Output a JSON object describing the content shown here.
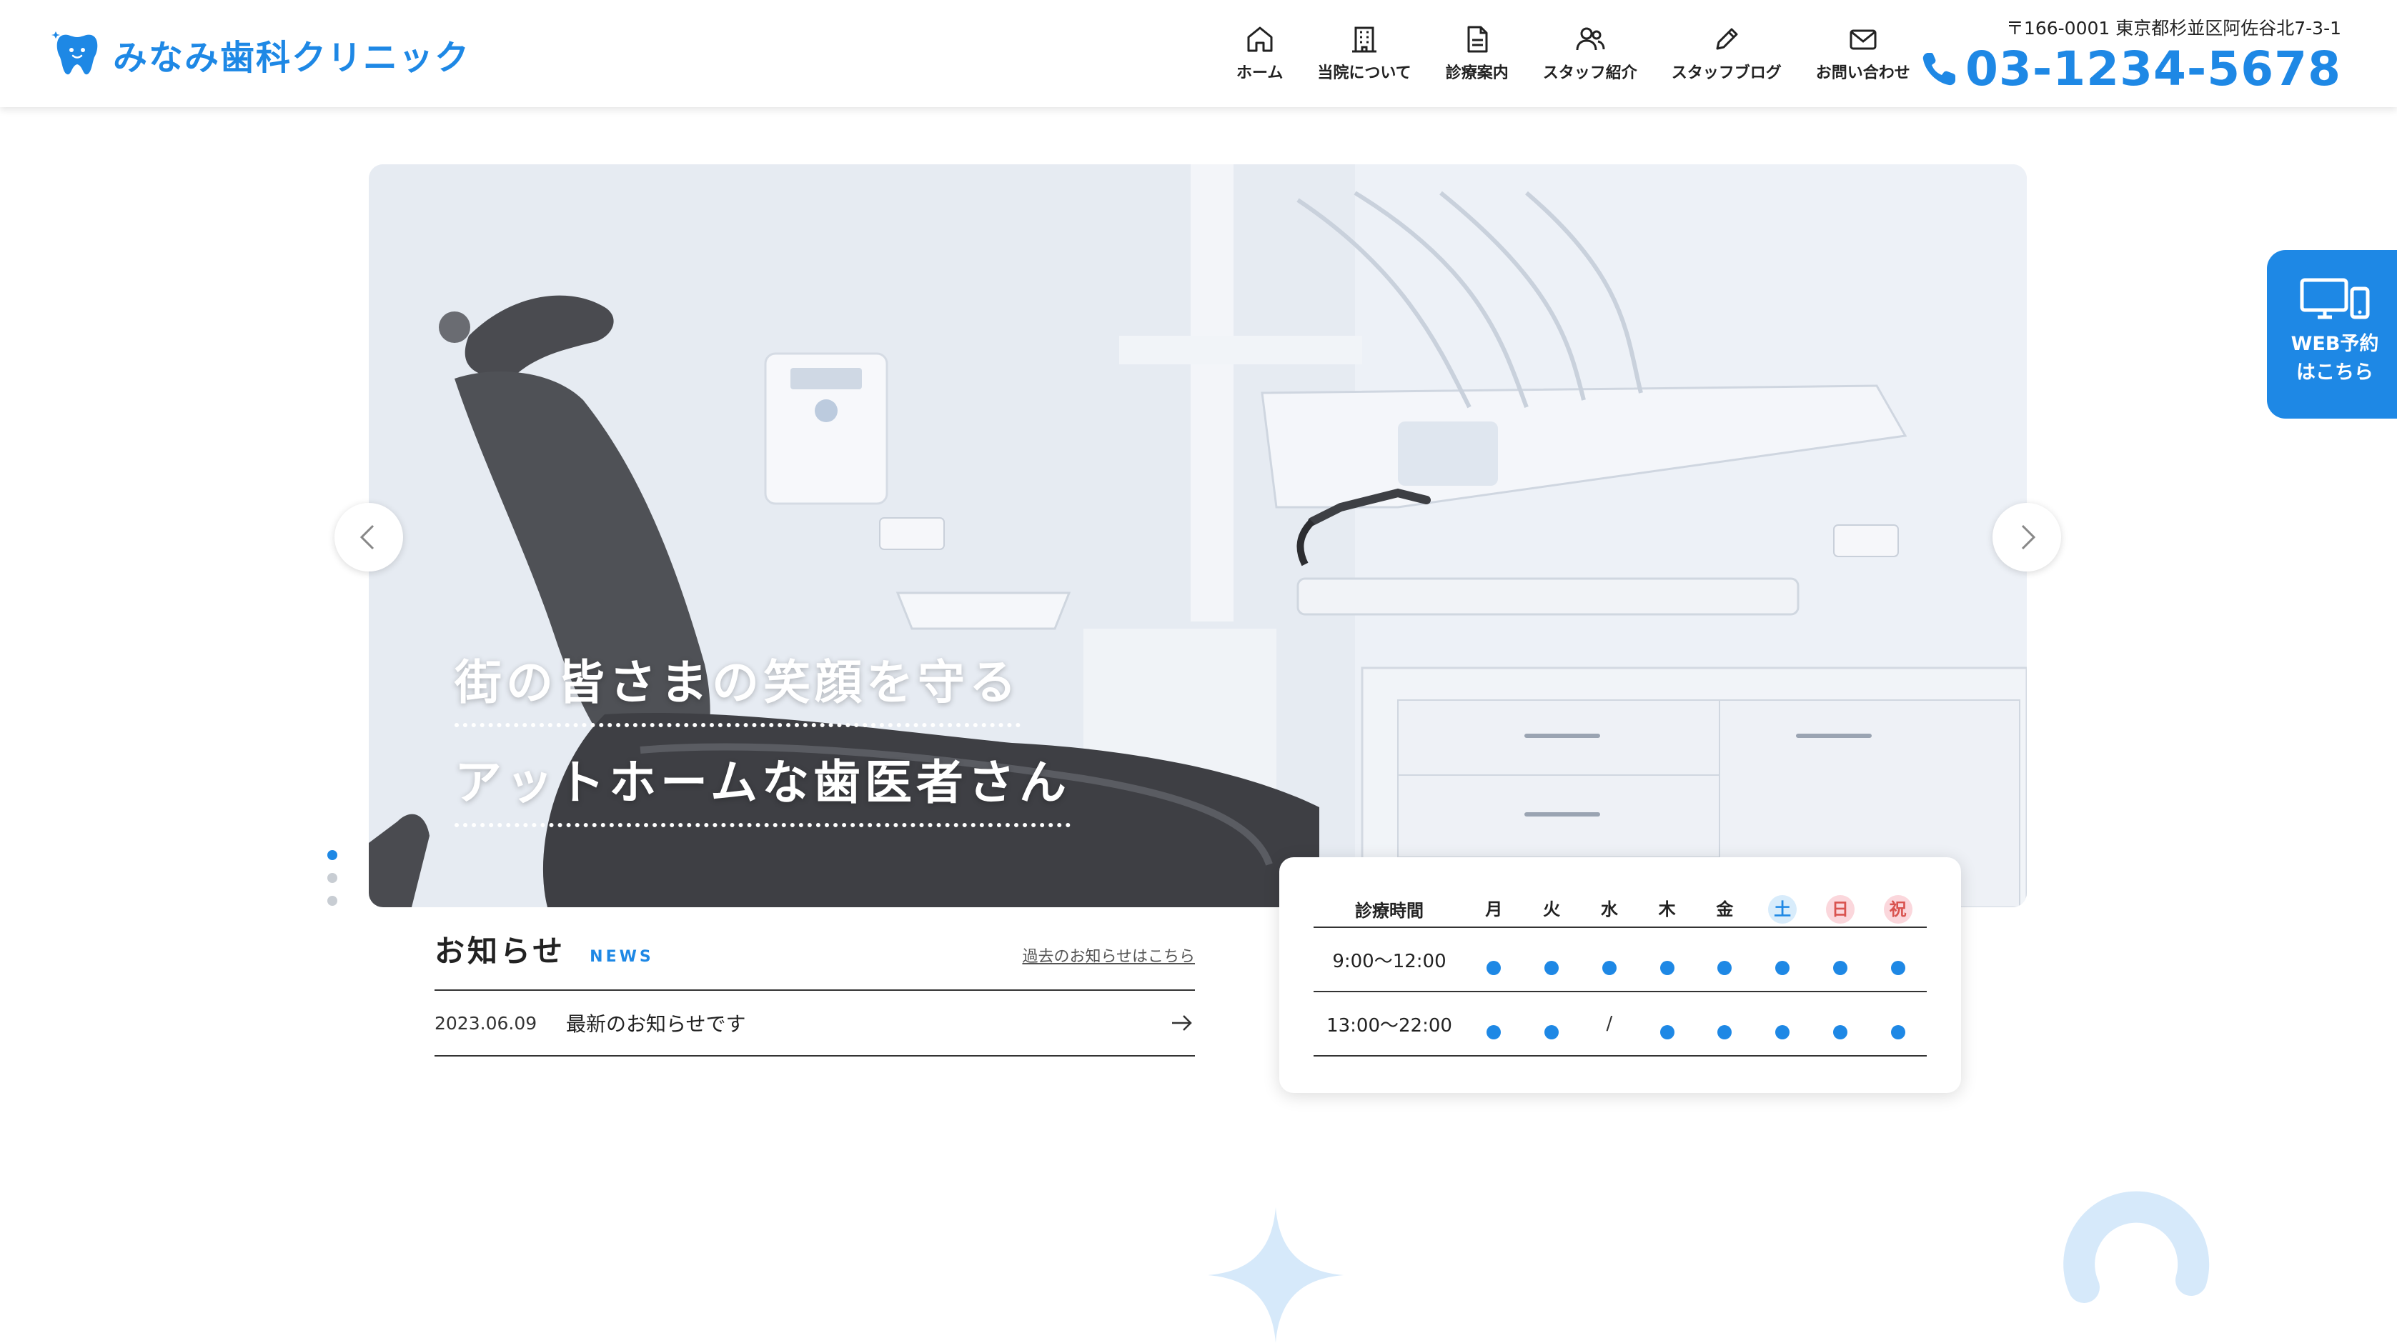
{
  "header": {
    "logo_text": "みなみ歯科クリニック",
    "nav": [
      {
        "label": "ホーム",
        "icon": "home-icon"
      },
      {
        "label": "当院について",
        "icon": "building-icon"
      },
      {
        "label": "診療案内",
        "icon": "document-icon"
      },
      {
        "label": "スタッフ紹介",
        "icon": "people-icon"
      },
      {
        "label": "スタッフブログ",
        "icon": "pencil-icon"
      },
      {
        "label": "お問い合わせ",
        "icon": "mail-icon"
      }
    ],
    "address": "〒166-0001 東京都杉並区阿佐谷北7-3-1",
    "phone": "03-1234-5678"
  },
  "web_reserve": {
    "line1": "WEB予約",
    "line2": "はこちら",
    "icon": "devices-icon"
  },
  "hero": {
    "line1": "街の皆さまの笑顔を守る",
    "line2": "アットホームな歯医者さん",
    "slide_count": 3,
    "active_slide": 1
  },
  "news": {
    "title": "お知らせ",
    "title_en": "NEWS",
    "more_link": "過去のお知らせはこちら",
    "items": [
      {
        "date": "2023.06.09",
        "text": "最新のお知らせです"
      }
    ]
  },
  "schedule": {
    "header_label": "診療時間",
    "days": [
      "月",
      "火",
      "水",
      "木",
      "金",
      "土",
      "日",
      "祝"
    ],
    "rows": [
      {
        "time": "9:00〜12:00",
        "marks": [
          "●",
          "●",
          "●",
          "●",
          "●",
          "●",
          "●",
          "●"
        ]
      },
      {
        "time": "13:00〜22:00",
        "marks": [
          "●",
          "●",
          "/",
          "●",
          "●",
          "●",
          "●",
          "●"
        ]
      }
    ]
  },
  "colors": {
    "accent": "#1e88e5",
    "saturday": "#d8ecfb",
    "sunday": "#fbd7dc"
  }
}
